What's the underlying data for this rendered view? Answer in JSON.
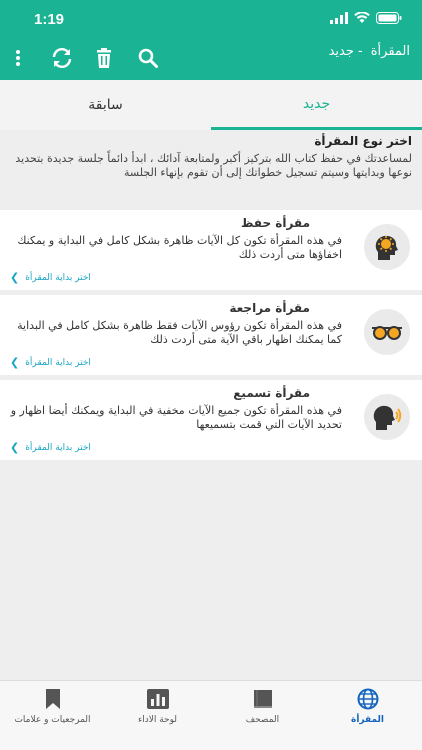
{
  "status_bar": {
    "time": "1:19"
  },
  "header": {
    "app_title": "المقرأة",
    "subtitle": "- جديد"
  },
  "tabs": [
    {
      "label": "جديد",
      "active": true
    },
    {
      "label": "سابقة",
      "active": false
    }
  ],
  "intro": {
    "title": "اختر نوع المقرأة",
    "body": "لمساعدتك في حفظ كتاب الله بتركيز أكبر ولمتابعة آدائك ، ابدأ دائماً جلسة جديدة بتحديد نوعها وبدايتها وسيتم تسجيل خطواتك إلى أن تقوم بإنهاء الجلسة"
  },
  "cards": [
    {
      "title": "مقرأة حفظ",
      "description": "في هذه المقرأة تكون كل الآيات ظاهرة بشكل كامل في البداية و يمكنك اخفاؤها متى أردت ذلك",
      "action": "اختر بداية المقرأة",
      "icon": "brain-icon"
    },
    {
      "title": "مقرأة مراجعة",
      "description": "في هذه المقرأة تكون رؤوس الآيات فقط ظاهرة بشكل كامل في البداية كما يمكنك اظهار باقي الآية متى أردت ذلك",
      "action": "اختر بداية المقرأة",
      "icon": "glasses-icon"
    },
    {
      "title": "مقرأة تسميع",
      "description": "في هذه المقرأة تكون جميع الآيات مخفية في البداية ويمكنك أيضا اظهار و تحديد الآيات التي قمت بتسميعها",
      "action": "اختر بداية المقرأة",
      "icon": "speaking-head-icon"
    }
  ],
  "bottom_nav": [
    {
      "label": "المقرأة",
      "icon": "globe-grid-icon",
      "active": true
    },
    {
      "label": "المصحف",
      "icon": "book-icon",
      "active": false
    },
    {
      "label": "لوحة الاداء",
      "icon": "bar-chart-icon",
      "active": false
    },
    {
      "label": "المرجعيات و علامات",
      "icon": "bookmark-icon",
      "active": false
    }
  ],
  "colors": {
    "primary": "#1ab394",
    "active_nav": "#1565c0",
    "link": "#1aa6c4"
  }
}
